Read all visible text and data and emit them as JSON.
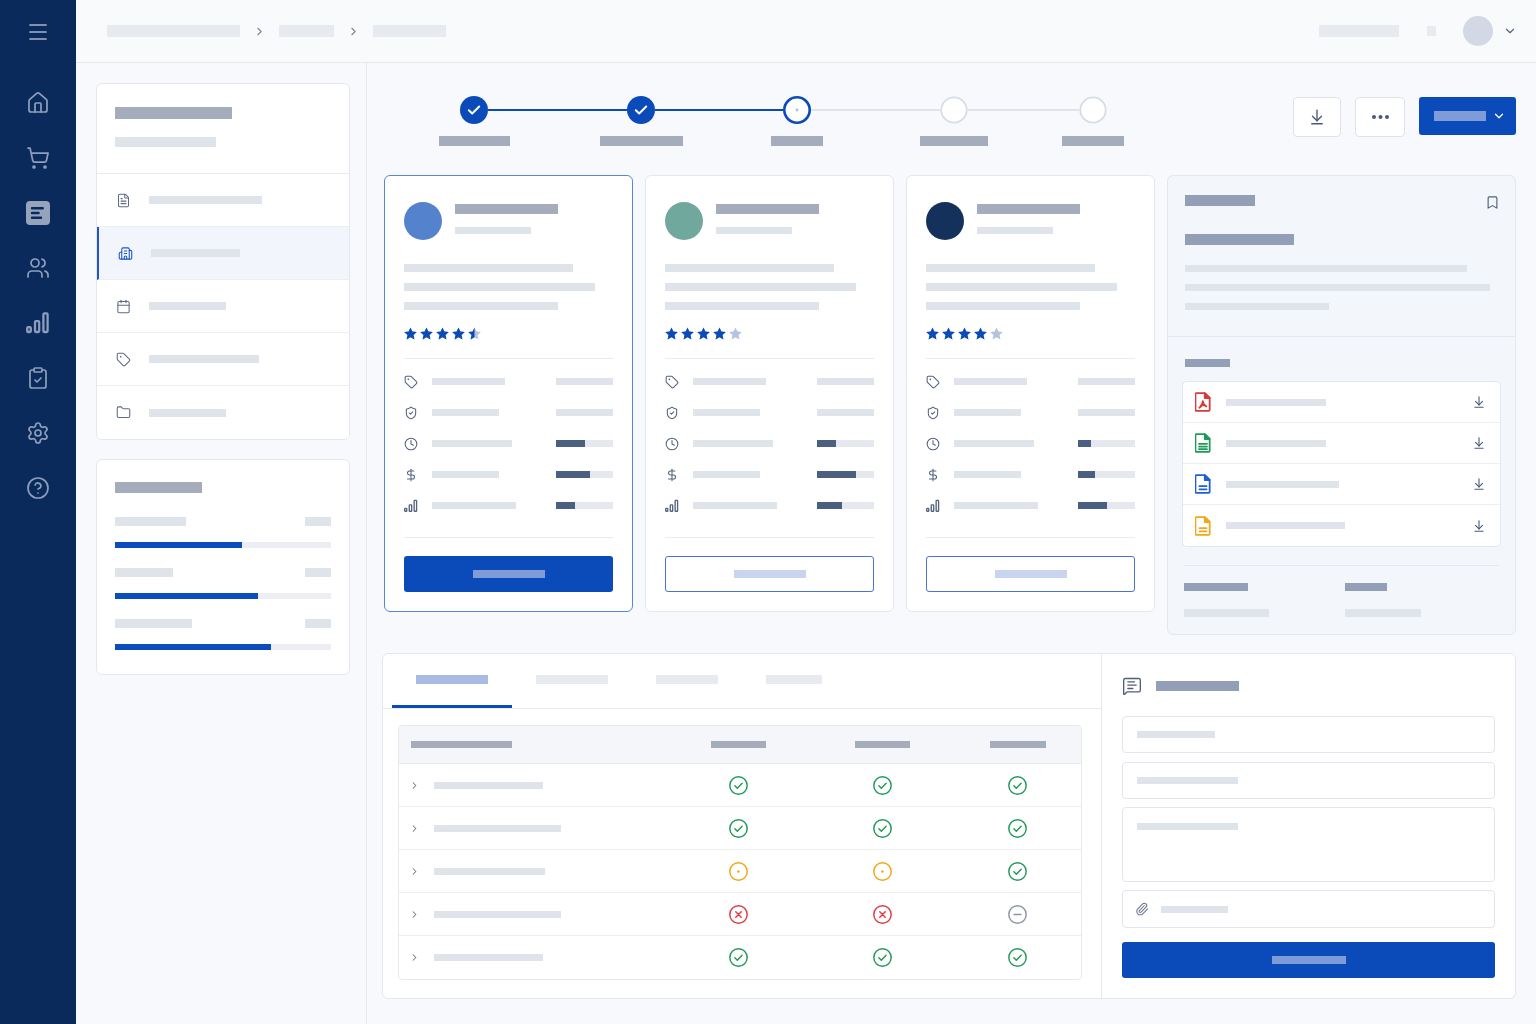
{
  "nav_rail": {
    "items": [
      {
        "selected": false
      },
      {
        "selected": false
      },
      {
        "selected": true
      },
      {
        "selected": false
      },
      {
        "selected": false
      },
      {
        "selected": false
      },
      {
        "selected": false
      },
      {
        "selected": false
      }
    ]
  },
  "side_list": {
    "items": [
      {
        "selected": false
      },
      {
        "selected": true
      },
      {
        "selected": false
      },
      {
        "selected": false
      },
      {
        "selected": false
      }
    ]
  },
  "goals": [
    {
      "level": 0.59
    },
    {
      "level": 0.66
    },
    {
      "level": 0.72
    }
  ],
  "stepper": {
    "steps": [
      {
        "done": true,
        "current": false
      },
      {
        "done": true,
        "current": false
      },
      {
        "done": false,
        "current": true
      },
      {
        "done": false,
        "current": false
      },
      {
        "done": false,
        "current": false
      }
    ]
  },
  "cards": [
    {
      "selected": true,
      "color": "#5482cc",
      "stars": 4.5,
      "metrics": [
        {
          "kind": "value"
        },
        {
          "kind": "value"
        },
        {
          "kind": "meter",
          "level": 0.5
        },
        {
          "kind": "meter",
          "level": 0.6
        },
        {
          "kind": "meter",
          "level": 0.33
        }
      ]
    },
    {
      "selected": false,
      "color": "#71a89e",
      "stars": 4,
      "metrics": [
        {
          "kind": "value"
        },
        {
          "kind": "value"
        },
        {
          "kind": "meter",
          "level": 0.33
        },
        {
          "kind": "meter",
          "level": 0.68
        },
        {
          "kind": "meter",
          "level": 0.43
        }
      ]
    },
    {
      "selected": false,
      "color": "#14315c",
      "stars": 4,
      "metrics": [
        {
          "kind": "value"
        },
        {
          "kind": "value"
        },
        {
          "kind": "meter",
          "level": 0.23
        },
        {
          "kind": "meter",
          "level": 0.29
        },
        {
          "kind": "meter",
          "level": 0.51
        }
      ]
    }
  ],
  "files": [
    {
      "kind": "pdf",
      "color": "#d93a3a"
    },
    {
      "kind": "sheet",
      "color": "#1e9a57"
    },
    {
      "kind": "doc",
      "color": "#1f5fd6"
    },
    {
      "kind": "doc",
      "color": "#f0a81a"
    }
  ],
  "tabs": [
    {
      "selected": true
    },
    {
      "selected": false
    },
    {
      "selected": false
    },
    {
      "selected": false
    }
  ],
  "table": {
    "rows": [
      {
        "expanded": false,
        "cells": [
          {
            "kind": "ok"
          },
          {
            "kind": "ok"
          },
          {
            "kind": "ok"
          }
        ]
      },
      {
        "expanded": false,
        "cells": [
          {
            "kind": "ok"
          },
          {
            "kind": "ok"
          },
          {
            "kind": "ok"
          }
        ]
      },
      {
        "expanded": false,
        "cells": [
          {
            "kind": "warning"
          },
          {
            "kind": "warning"
          },
          {
            "kind": "ok"
          }
        ]
      },
      {
        "expanded": false,
        "cells": [
          {
            "kind": "error"
          },
          {
            "kind": "error"
          },
          {
            "kind": "neutral"
          }
        ]
      },
      {
        "expanded": false,
        "cells": [
          {
            "kind": "ok"
          },
          {
            "kind": "ok"
          },
          {
            "kind": "ok"
          }
        ]
      }
    ]
  }
}
